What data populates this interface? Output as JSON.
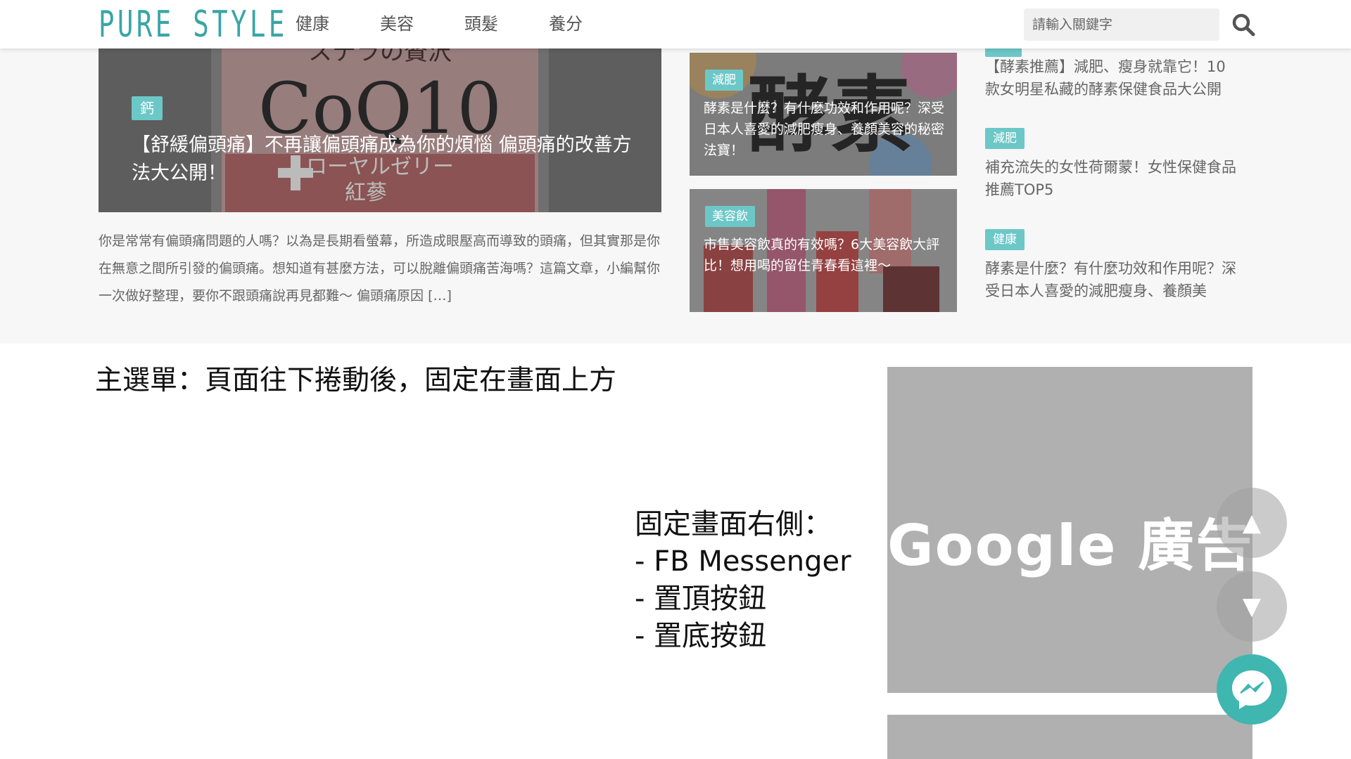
{
  "header": {
    "logo": "PURE STYLE",
    "nav": [
      "健康",
      "美容",
      "頭髮",
      "養分"
    ],
    "search_placeholder": "請輸入關鍵字"
  },
  "hero": {
    "image_text_1": "CoQ10",
    "image_text_2": "ローヤルゼリー",
    "image_text_3": "紅蔘",
    "image_text_top": "ステラの贅沢",
    "tag": "鈣",
    "title": "【舒緩偏頭痛】不再讓偏頭痛成為你的煩惱 偏頭痛的改善方法大公開！",
    "excerpt": "你是常常有偏頭痛問題的人嗎？以為是長期看螢幕，所造成眼壓高而導致的頭痛，但其實那是你在無意之間所引發的偏頭痛。想知道有甚麼方法，可以脫離偏頭痛苦海嗎？這篇文章，小編幫你一次做好整理，要你不跟頭痛說再見都難～ 偏頭痛原因 […]"
  },
  "mid_cards": [
    {
      "tag": "減肥",
      "image_text": "酵素",
      "title": "酵素是什麼？有什麼功效和作用呢？深受日本人喜愛的減肥瘦身、養顏美容的秘密法寶！"
    },
    {
      "tag": "美容飲",
      "title": "市售美容飲真的有效嗎？6大美容飲大評比！想用喝的留住青春看這裡～"
    }
  ],
  "side_list": [
    {
      "title": "【酵素推薦】減肥、瘦身就靠它！10款女明星私藏的酵素保健食品大公開"
    },
    {
      "tag": "減肥",
      "title": "補充流失的女性荷爾蒙！女性保健食品推薦TOP5"
    },
    {
      "tag": "健康",
      "title": "酵素是什麼？有什麼功效和作用呢？深受日本人喜愛的減肥瘦身、養顏美"
    }
  ],
  "notes": {
    "main_menu": "主選單：頁面往下捲動後，固定在畫面上方",
    "right_fixed": [
      "固定畫面右側：",
      "- FB Messenger",
      "- 置頂按鈕",
      "- 置底按鈕"
    ]
  },
  "ad": {
    "label": "Google 廣告"
  },
  "floating": {
    "top_symbol": "▲",
    "bottom_symbol": "▼"
  },
  "colors": {
    "brand": "#3aa5a5",
    "tag": "#6cc7c7",
    "messenger": "#3fb6b0",
    "ad": "#b0b0b0"
  }
}
